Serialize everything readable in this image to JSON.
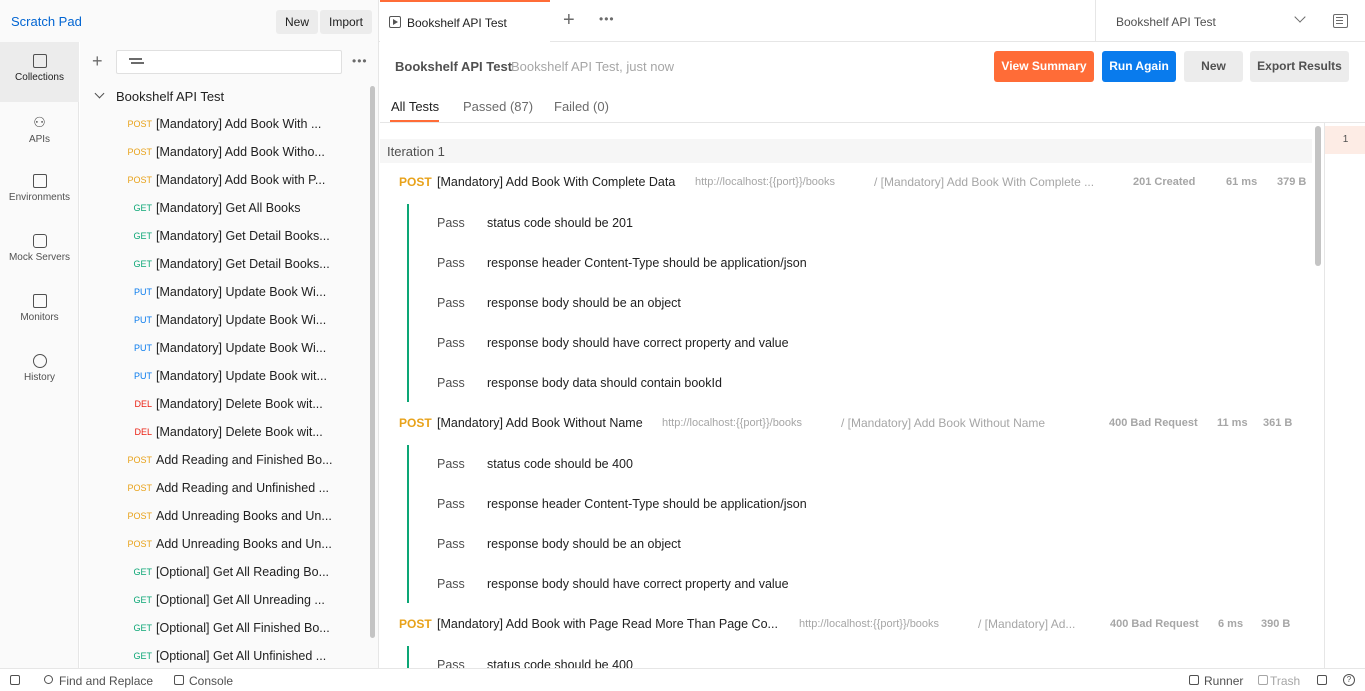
{
  "workspace": {
    "name": "Scratch Pad",
    "new_label": "New",
    "import_label": "Import"
  },
  "tabbar": {
    "tab_label": "Bookshelf API Test",
    "add_icon": "plus-icon",
    "more_icon": "ellipsis-icon"
  },
  "environment": {
    "selected": "Bookshelf API Test",
    "eye_icon": "environment-quicklook-icon"
  },
  "nav_rail": [
    {
      "label": "Collections",
      "icon": "collections-icon"
    },
    {
      "label": "APIs",
      "icon": "apis-icon"
    },
    {
      "label": "Environments",
      "icon": "environments-icon"
    },
    {
      "label": "Mock Servers",
      "icon": "mock-servers-icon"
    },
    {
      "label": "Monitors",
      "icon": "monitors-icon"
    },
    {
      "label": "History",
      "icon": "history-icon"
    }
  ],
  "sidebar": {
    "collection_name": "Bookshelf API Test",
    "requests": [
      {
        "method": "POST",
        "name": "[Mandatory] Add Book With ..."
      },
      {
        "method": "POST",
        "name": "[Mandatory] Add Book Witho..."
      },
      {
        "method": "POST",
        "name": "[Mandatory] Add Book with P..."
      },
      {
        "method": "GET",
        "name": "[Mandatory] Get All Books"
      },
      {
        "method": "GET",
        "name": "[Mandatory] Get Detail Books..."
      },
      {
        "method": "GET",
        "name": "[Mandatory] Get Detail Books..."
      },
      {
        "method": "PUT",
        "name": "[Mandatory] Update Book Wi..."
      },
      {
        "method": "PUT",
        "name": "[Mandatory] Update Book Wi..."
      },
      {
        "method": "PUT",
        "name": "[Mandatory] Update Book Wi..."
      },
      {
        "method": "PUT",
        "name": "[Mandatory] Update Book wit..."
      },
      {
        "method": "DEL",
        "name": "[Mandatory] Delete Book wit..."
      },
      {
        "method": "DEL",
        "name": "[Mandatory] Delete Book wit..."
      },
      {
        "method": "POST",
        "name": "Add Reading and Finished Bo..."
      },
      {
        "method": "POST",
        "name": "Add Reading and Unfinished ..."
      },
      {
        "method": "POST",
        "name": "Add Unreading Books and Un..."
      },
      {
        "method": "POST",
        "name": "Add Unreading Books and Un..."
      },
      {
        "method": "GET",
        "name": "[Optional] Get All Reading Bo..."
      },
      {
        "method": "GET",
        "name": "[Optional] Get All Unreading ..."
      },
      {
        "method": "GET",
        "name": "[Optional] Get All Finished Bo..."
      },
      {
        "method": "GET",
        "name": "[Optional] Get All Unfinished ..."
      }
    ]
  },
  "run": {
    "title": "Bookshelf API Test",
    "subtitle": "Bookshelf API Test, just now",
    "view_summary": "View Summary",
    "run_again": "Run Again",
    "new": "New",
    "export": "Export Results",
    "tabs": {
      "all": "All Tests",
      "passed": "Passed (87)",
      "failed": "Failed (0)"
    },
    "iteration_label": "Iteration 1",
    "gutter_iteration": "1",
    "results": [
      {
        "method": "POST",
        "name": "[Mandatory] Add Book With Complete Data",
        "url": "http://localhost:{{port}}/books",
        "path": "/ [Mandatory] Add Book With Complete ...",
        "status": "201 Created",
        "time": "61 ms",
        "size": "379 B",
        "tests": [
          {
            "result": "Pass",
            "name": "status code should be 201"
          },
          {
            "result": "Pass",
            "name": "response header Content-Type should be application/json"
          },
          {
            "result": "Pass",
            "name": "response body should be an object"
          },
          {
            "result": "Pass",
            "name": "response body should have correct property and value"
          },
          {
            "result": "Pass",
            "name": "response body data should contain bookId"
          }
        ]
      },
      {
        "method": "POST",
        "name": "[Mandatory] Add Book Without Name",
        "url": "http://localhost:{{port}}/books",
        "path": "/ [Mandatory] Add Book Without Name",
        "status": "400 Bad Request",
        "time": "11 ms",
        "size": "361 B",
        "tests": [
          {
            "result": "Pass",
            "name": "status code should be 400"
          },
          {
            "result": "Pass",
            "name": "response header Content-Type should be application/json"
          },
          {
            "result": "Pass",
            "name": "response body should be an object"
          },
          {
            "result": "Pass",
            "name": "response body should have correct property and value"
          }
        ]
      },
      {
        "method": "POST",
        "name": "[Mandatory] Add Book with Page Read More Than Page Co...",
        "url": "http://localhost:{{port}}/books",
        "path": "/ [Mandatory] Ad...",
        "status": "400 Bad Request",
        "time": "6 ms",
        "size": "390 B",
        "tests": [
          {
            "result": "Pass",
            "name": "status code should be 400"
          }
        ]
      }
    ]
  },
  "footer": {
    "find_replace": "Find and Replace",
    "console": "Console",
    "runner": "Runner",
    "trash": "Trash",
    "help_glyph": "?"
  },
  "colors": {
    "accent_orange": "#ff6c37",
    "accent_blue": "#097bed",
    "post": "#e8a21a",
    "get": "#0ca675",
    "put": "#097bed",
    "delete": "#eb2013",
    "pass_bar": "#0ca675"
  }
}
